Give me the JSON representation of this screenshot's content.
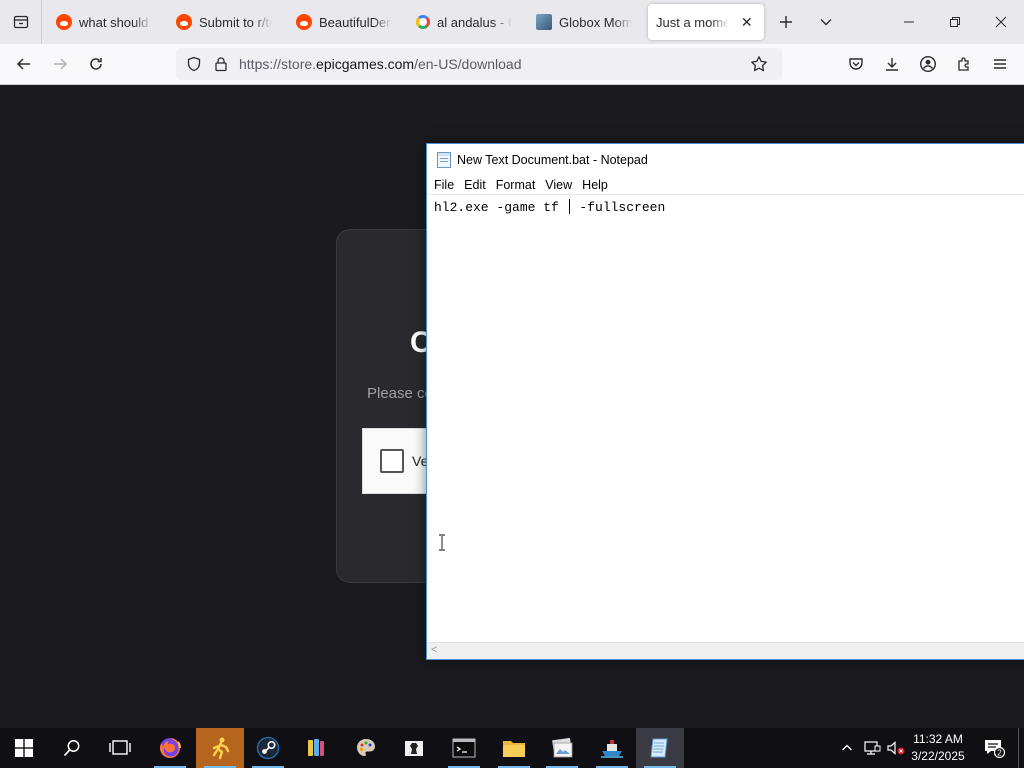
{
  "browser": {
    "tabs": [
      {
        "label": "what should s",
        "icon": "reddit-icon"
      },
      {
        "label": "Submit to r/te",
        "icon": "reddit-icon"
      },
      {
        "label": "BeautifulDens",
        "icon": "reddit-icon"
      },
      {
        "label": "al andalus - G",
        "icon": "google-icon"
      },
      {
        "label": "Globox Mome",
        "icon": "globox-icon"
      },
      {
        "label": "Just a moment.",
        "icon": "none",
        "active": true
      }
    ],
    "url_prefix": "https://store.",
    "url_host": "epicgames.com",
    "url_path": "/en-US/download"
  },
  "page": {
    "card_title_fragment": "C",
    "card_sub_fragment": "Please co",
    "captcha_label_fragment": "Ve"
  },
  "notepad": {
    "title": "New Text Document.bat - Notepad",
    "menu": [
      "File",
      "Edit",
      "Format",
      "View",
      "Help"
    ],
    "text_before_caret": "hl2.exe -game tf ",
    "text_after_caret": " -fullscreen"
  },
  "taskbar": {
    "apps": [
      "firefox-icon",
      "runner-icon",
      "steam-icon",
      "paint-tubes-icon",
      "palette-icon",
      "chess-icon",
      "terminal-icon",
      "folder-icon",
      "photos-icon",
      "boat-icon",
      "notepad-icon"
    ],
    "time": "11:32 AM",
    "date": "3/22/2025",
    "notification_count": "2"
  },
  "colors": {
    "page_bg": "#1b1b1f",
    "taskbar_bg": "#101014",
    "accent": "#76b9ed"
  }
}
